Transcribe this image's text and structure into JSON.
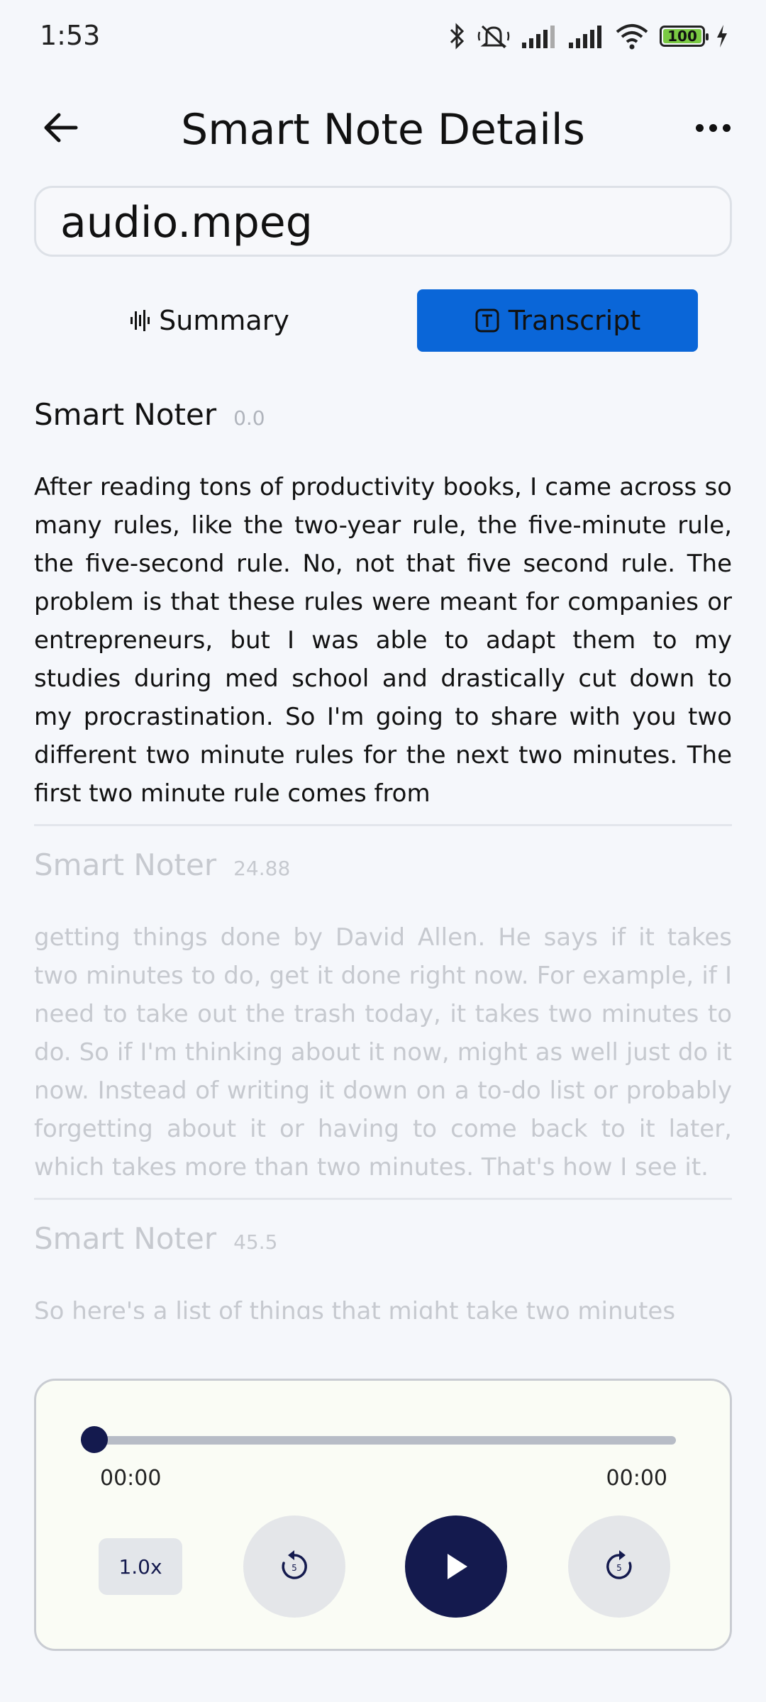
{
  "status": {
    "time": "1:53",
    "battery": "100",
    "icons": [
      "bluetooth-icon",
      "mute-icon",
      "signal-icon",
      "signal-icon",
      "wifi-icon",
      "battery-icon",
      "charging-icon"
    ]
  },
  "header": {
    "title": "Smart Note Details",
    "back_icon": "arrow-left-icon",
    "more_icon": "more-horizontal-icon"
  },
  "file": {
    "name": "audio.mpeg"
  },
  "tabs": [
    {
      "label": "Summary",
      "icon": "waveform-icon",
      "active": false
    },
    {
      "label": "Transcript",
      "icon": "text-box-icon",
      "active": true
    }
  ],
  "transcript": [
    {
      "speaker": "Smart Noter",
      "time": "0.0",
      "text": "After reading tons of productivity books, I came across so many rules, like the two-year rule, the five-minute rule, the five-second rule. No, not that five second rule. The problem is that these rules were meant for companies or entrepreneurs, but I was able to adapt them to my studies during med school and drastically cut down to my procrastination. So I'm going to share with you two different two minute rules for the next two minutes. The first two minute rule comes from"
    },
    {
      "speaker": "Smart Noter",
      "time": "24.88",
      "text": "getting things done by David Allen. He says if it takes two minutes to do, get it done right now. For example, if I need to take out the trash today, it takes two minutes to do. So if I'm thinking about it now, might as well just do it now. Instead of writing it down on a to-do list or probably forgetting about it or having to come back to it later, which takes more than two minutes. That's how I see it."
    },
    {
      "speaker": "Smart Noter",
      "time": "45.5",
      "text": "So here's a list of things that might take two minutes"
    }
  ],
  "player": {
    "current_time": "00:00",
    "duration": "00:00",
    "progress": 0,
    "speed": "1.0x",
    "rewind_seconds": "5",
    "forward_seconds": "5",
    "accent": "#141a4e"
  },
  "colors": {
    "active_tab": "#0a66d8",
    "background": "#f5f7fb"
  }
}
